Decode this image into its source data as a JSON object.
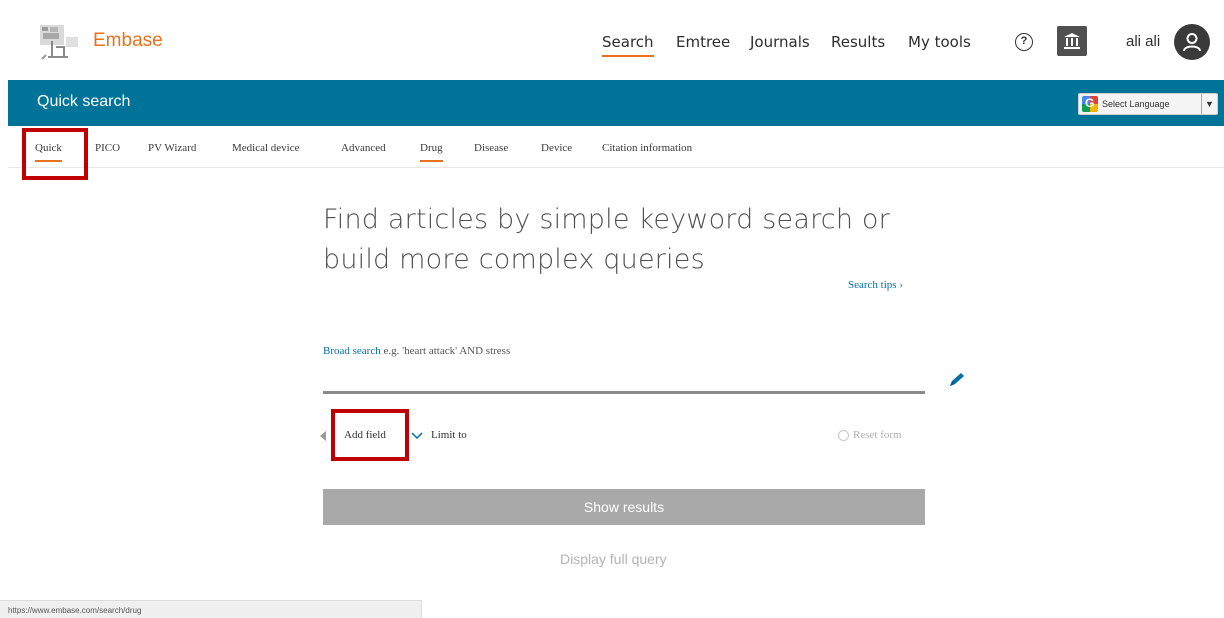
{
  "brand": {
    "name": "Embase",
    "accent": "#e9711c",
    "primary": "#007398"
  },
  "top_nav": [
    {
      "label": "Search",
      "active": true
    },
    {
      "label": "Emtree"
    },
    {
      "label": "Journals"
    },
    {
      "label": "Results"
    },
    {
      "label": "My tools"
    }
  ],
  "header_icons": {
    "help": "help-circle-icon",
    "institution": "institution-icon",
    "avatar": "user-icon"
  },
  "user": {
    "name": "ali ali"
  },
  "page_bar": {
    "title": "Quick search",
    "language_label": "Select Language",
    "language_arrow": "▼"
  },
  "sub_tabs": [
    {
      "label": "Quick",
      "active": true
    },
    {
      "label": "PICO"
    },
    {
      "label": "PV Wizard"
    },
    {
      "label": "Medical device"
    },
    {
      "label": "Advanced"
    },
    {
      "label": "Drug",
      "hover": true
    },
    {
      "label": "Disease"
    },
    {
      "label": "Device"
    },
    {
      "label": "Citation information"
    }
  ],
  "main": {
    "heading": "Find articles by simple keyword search or build more complex queries",
    "search_tips": "Search tips ›",
    "field_label_link": "Broad search",
    "field_label_hint": " e.g. 'heart attack' AND stress",
    "search_value": "",
    "add_field": "Add field",
    "limit_to": "Limit to",
    "reset_form": "Reset form",
    "show_results": "Show results",
    "display_full_query": "Display full query"
  },
  "status_bar": {
    "url": "https://www.embase.com/search/drug"
  },
  "highlight_color": "#c00000"
}
